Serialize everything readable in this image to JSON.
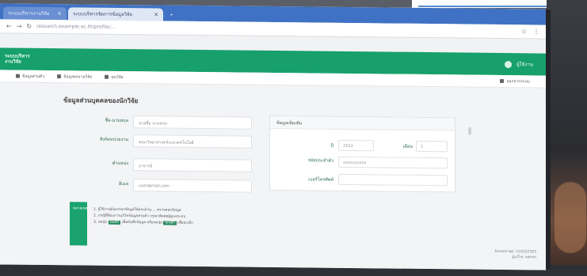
{
  "browser": {
    "tabs": [
      {
        "label": "ระบบบริหารงานวิจัย"
      },
      {
        "label": "ระบบบริหารจัดการข้อมูลวิจัย"
      }
    ],
    "new_tab_symbol": "+",
    "close_symbol": "×",
    "address": "research.example.ac.th/profile/..."
  },
  "app": {
    "brand_line1": "ระบบบริหาร",
    "brand_line2": "งานวิจัย",
    "user_name": "ผู้ใช้งาน"
  },
  "nav": {
    "items": [
      {
        "label": "ข้อมูลส่วนตัว"
      },
      {
        "label": "ข้อมูลผลงานวิจัย"
      },
      {
        "label": "ทุนวิจัย"
      }
    ],
    "right_label": "ออกจากระบบ"
  },
  "page": {
    "title": "ข้อมูลส่วนบุคคลของนักวิจัย"
  },
  "profile_fields": [
    {
      "label": "ชื่อ-นามสกุล",
      "value": "นายชื่อ นามสกุล"
    },
    {
      "label": "สังกัดหน่วยงาน",
      "value": "คณะวิทยาศาสตร์และเทคโนโลยี"
    },
    {
      "label": "ตำแหน่ง",
      "value": "อาจารย์"
    },
    {
      "label": "อีเมล",
      "value": "user@mail.com"
    }
  ],
  "right_panel": {
    "header": "ข้อมูลเพิ่มเติม",
    "fields": [
      {
        "label": "ปี",
        "value": "2563"
      },
      {
        "label": "เดือน",
        "value": "1"
      },
      {
        "label": "รหัสประจำตัว",
        "value": "xxxxxxxxxx"
      },
      {
        "label": "เบอร์โทรศัพท์",
        "value": ""
      }
    ]
  },
  "notice": {
    "badge": "หมายเหตุ",
    "line1": "1. ผู้ใช้งานต้องกรอกข้อมูลให้ครบถ้วน ... ตรวจสอบข้อมูล",
    "line2": "2. กรณีที่ต้องการแก้ไขข้อมูลส่วนตัว กรุณาติดต่อผู้ดูแลระบบ",
    "line3_pre": "3. กดปุ่ม",
    "line3_hl1": "บันทึก",
    "line3_mid": "เพื่อบันทึกข้อมูล หรือกดปุ่ม",
    "line3_hl2": "ยกเลิก",
    "line3_post": "เพื่อยกเลิก"
  },
  "footer": {
    "line1": "อัปเดตล่าสุด: 12/03/2563",
    "line2": "ผู้แก้ไข: admin"
  }
}
